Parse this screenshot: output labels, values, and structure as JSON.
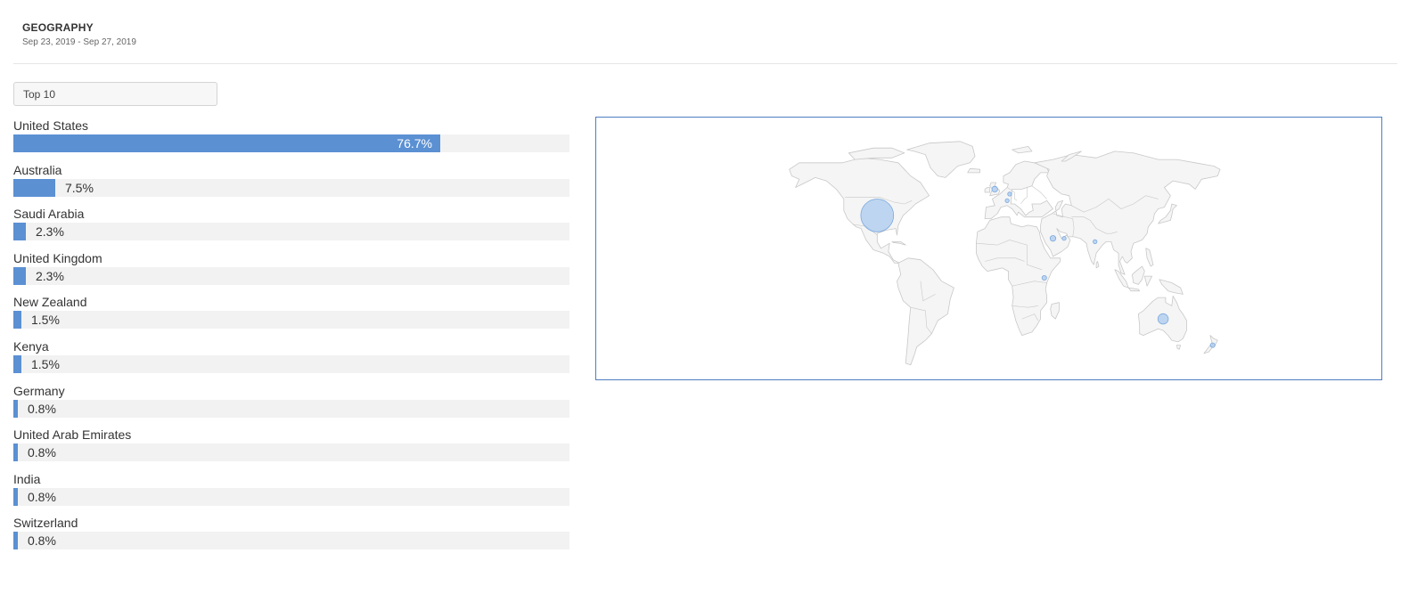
{
  "header": {
    "title": "GEOGRAPHY",
    "date_range": "Sep 23, 2019 - Sep 27, 2019"
  },
  "filter": {
    "selected": "Top 10"
  },
  "countries": [
    {
      "name": "United States",
      "percent_label": "76.7%",
      "value": 76.7,
      "lat": 38,
      "lon": -97
    },
    {
      "name": "Australia",
      "percent_label": "7.5%",
      "value": 7.5,
      "lat": -25,
      "lon": 134
    },
    {
      "name": "Saudi Arabia",
      "percent_label": "2.3%",
      "value": 2.3,
      "lat": 24,
      "lon": 45
    },
    {
      "name": "United Kingdom",
      "percent_label": "2.3%",
      "value": 2.3,
      "lat": 54,
      "lon": -2
    },
    {
      "name": "New Zealand",
      "percent_label": "1.5%",
      "value": 1.5,
      "lat": -41,
      "lon": 174
    },
    {
      "name": "Kenya",
      "percent_label": "1.5%",
      "value": 1.5,
      "lat": 0,
      "lon": 38
    },
    {
      "name": "Germany",
      "percent_label": "0.8%",
      "value": 0.8,
      "lat": 51,
      "lon": 10
    },
    {
      "name": "United Arab Emirates",
      "percent_label": "0.8%",
      "value": 0.8,
      "lat": 24,
      "lon": 54
    },
    {
      "name": "India",
      "percent_label": "0.8%",
      "value": 0.8,
      "lat": 22,
      "lon": 79
    },
    {
      "name": "Switzerland",
      "percent_label": "0.8%",
      "value": 0.8,
      "lat": 47,
      "lon": 8
    }
  ],
  "colors": {
    "bar": "#5b90d3",
    "track": "#f2f2f2",
    "bubble_fill": "#a9c9ee",
    "bubble_stroke": "#7aa7dd",
    "land": "#f5f5f5",
    "border": "#c8c8c8",
    "map_frame": "#4e7ec1"
  }
}
